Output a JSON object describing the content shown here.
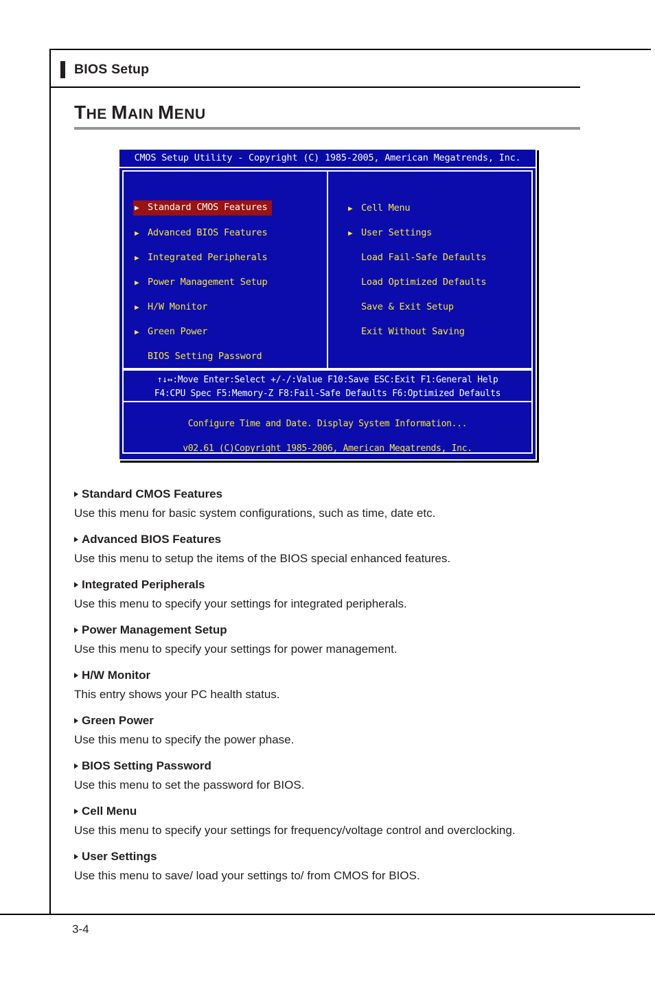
{
  "running_head": {
    "label": "BIOS Setup"
  },
  "section": {
    "heading_parts": [
      "T",
      "HE ",
      "M",
      "AIN ",
      "M",
      "ENU"
    ],
    "heading_plain": "THE MAIN MENU"
  },
  "bios": {
    "title": "CMOS Setup Utility - Copyright (C) 1985-2005, American Megatrends, Inc.",
    "left_items": [
      {
        "label": "Standard CMOS Features",
        "arrow": true,
        "selected": true
      },
      {
        "label": "Advanced BIOS Features",
        "arrow": true,
        "selected": false
      },
      {
        "label": "Integrated Peripherals",
        "arrow": true,
        "selected": false
      },
      {
        "label": "Power Management Setup",
        "arrow": true,
        "selected": false
      },
      {
        "label": "H/W Monitor",
        "arrow": true,
        "selected": false
      },
      {
        "label": "Green Power",
        "arrow": true,
        "selected": false
      },
      {
        "label": "BIOS Setting Password",
        "arrow": false,
        "selected": false
      }
    ],
    "right_items": [
      {
        "label": "Cell Menu",
        "arrow": true,
        "selected": false
      },
      {
        "label": "User Settings",
        "arrow": true,
        "selected": false
      },
      {
        "label": "Load Fail-Safe Defaults",
        "arrow": false,
        "selected": false
      },
      {
        "label": "Load Optimized Defaults",
        "arrow": false,
        "selected": false
      },
      {
        "label": "Save & Exit Setup",
        "arrow": false,
        "selected": false
      },
      {
        "label": "Exit Without Saving",
        "arrow": false,
        "selected": false
      }
    ],
    "key_help_line1": "↑↓↔:Move  Enter:Select  +/-/:Value  F10:Save  ESC:Exit  F1:General Help",
    "key_help_line2": "F4:CPU Spec  F5:Memory-Z  F8:Fail-Safe Defaults  F6:Optimized Defaults",
    "hint_line": "Configure Time and Date.  Display System Information...",
    "version_line": "v02.61 (C)Copyright 1985-2006, American Megatrends, Inc.",
    "colors": {
      "screen_bg": "#0c0cac",
      "item_text": "#f5e73c",
      "selected_bg": "#9a1212",
      "selected_text": "#ffffff",
      "help_text": "#ffffff",
      "border": "#ffffff"
    }
  },
  "descriptions": [
    {
      "title": "Standard CMOS Features",
      "body": "Use this menu for basic system configurations, such as time, date etc."
    },
    {
      "title": "Advanced BIOS Features",
      "body": "Use this menu to setup the items of the BIOS special enhanced features."
    },
    {
      "title": "Integrated Peripherals",
      "body": "Use this menu to specify your settings for integrated peripherals."
    },
    {
      "title": "Power Management Setup",
      "body": "Use this menu to specify your settings for power management."
    },
    {
      "title": "H/W Monitor",
      "body": "This entry shows your PC health status."
    },
    {
      "title": "Green Power",
      "body": "Use this menu to specify the power phase."
    },
    {
      "title": "BIOS Setting Password",
      "body": "Use this menu to set the password for BIOS."
    },
    {
      "title": "Cell Menu",
      "body": "Use this menu to specify your settings for frequency/voltage control and overclocking."
    },
    {
      "title": "User Settings",
      "body": "Use this menu to save/ load your settings to/ from CMOS for BIOS."
    }
  ],
  "folio": {
    "page_number": "3-4"
  }
}
